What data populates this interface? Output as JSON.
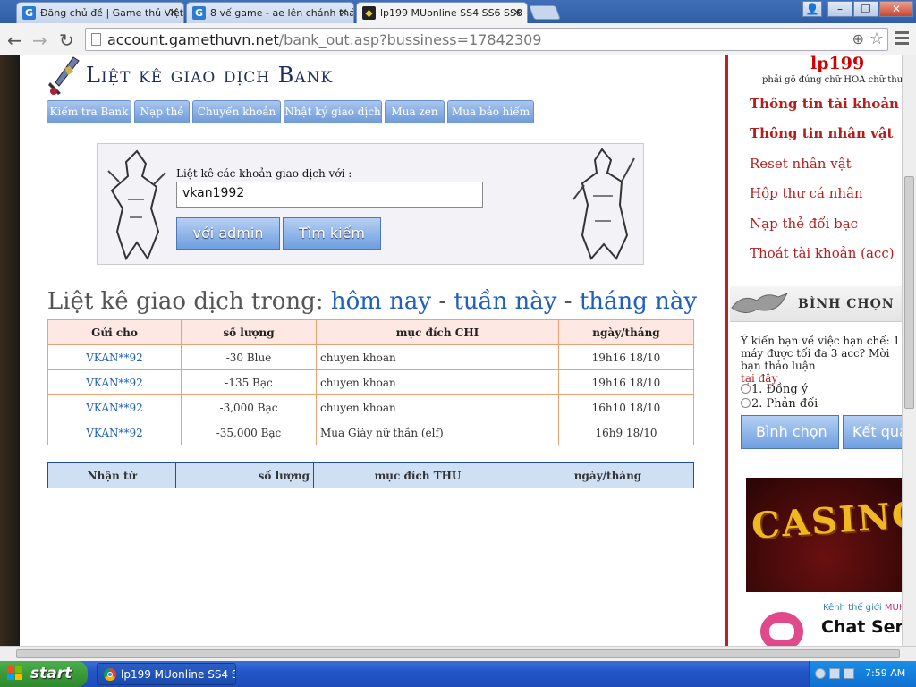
{
  "browser": {
    "tabs": [
      {
        "label": "Đăng chủ đề | Game thủ Việt",
        "favicon": "G"
      },
      {
        "label": "8 vế game - ae lên chánh thá",
        "favicon": "G"
      },
      {
        "label": "lp199 MUonline SS4 SS6 SS8",
        "favicon": "mu"
      }
    ],
    "url_domain": "account.gamethuvn.net",
    "url_path": "/bank_out.asp?bussiness=17842309"
  },
  "page": {
    "title": "Liệt kê giao dịch Bank",
    "tabs": [
      "Kiểm tra Bank",
      "Nạp thẻ",
      "Chuyển khoản",
      "Nhật ký giao dịch",
      "Mua zen",
      "Mua bảo hiểm"
    ],
    "search": {
      "label": "Liệt kê các khoản giao dịch với :",
      "value": "vkan1992",
      "btn_admin": "với admin",
      "btn_search": "Tìm kiếm"
    },
    "period": {
      "prefix": "Liệt kê giao dịch trong:",
      "today": "hôm nay",
      "sep": "-",
      "week": "tuần này",
      "month": "tháng này"
    },
    "out_table": {
      "headers": [
        "Gửi cho",
        "số lượng",
        "mục đích CHI",
        "ngày/tháng"
      ],
      "rows": [
        {
          "to": "VKAN**92",
          "amount": "-30  Blue",
          "purpose": "chuyen khoan",
          "date": "19h16 18/10"
        },
        {
          "to": "VKAN**92",
          "amount": "-135  Bạc",
          "purpose": "chuyen khoan",
          "date": "19h16 18/10"
        },
        {
          "to": "VKAN**92",
          "amount": "-3,000  Bạc",
          "purpose": "chuyen khoan",
          "date": "16h10 18/10"
        },
        {
          "to": "VKAN**92",
          "amount": "-35,000  Bạc",
          "purpose": "Mua Giày nữ thần (elf)",
          "date": "16h9 18/10"
        }
      ]
    },
    "in_table": {
      "headers": [
        "Nhận từ",
        "số lượng",
        "mục đích THU",
        "ngày/tháng"
      ]
    }
  },
  "sidebar": {
    "username": "lp199",
    "note": "phải gõ đúng chữ HOA chữ thường",
    "links": [
      "Thông tin tài khoản",
      "Thông tin nhân vật",
      "Reset nhân vật",
      "Hộp thư cá nhân",
      "Nạp thẻ đổi bạc",
      "Thoát tài khoản (acc)"
    ],
    "vote": {
      "heading": "BÌNH CHỌN",
      "question": "Ý kiến bạn về việc hạn chế: 1 máy được tối đa 3 acc? Mời bạn thảo luận",
      "question_link": "tại đây",
      "options": [
        "1. Đồng ý",
        "2. Phản đối"
      ],
      "btn_vote": "Bình chọn",
      "btn_result": "Kết quả"
    },
    "ad_casino": "CASINO",
    "ad_chat_line1": "Kênh thế giới",
    "ad_chat_brand": "MUH",
    "ad_chat_line2": "Chat Server"
  },
  "taskbar": {
    "start": "start",
    "task_item": "lp199 MUonline SS4 S...",
    "clock": "7:59 AM"
  }
}
